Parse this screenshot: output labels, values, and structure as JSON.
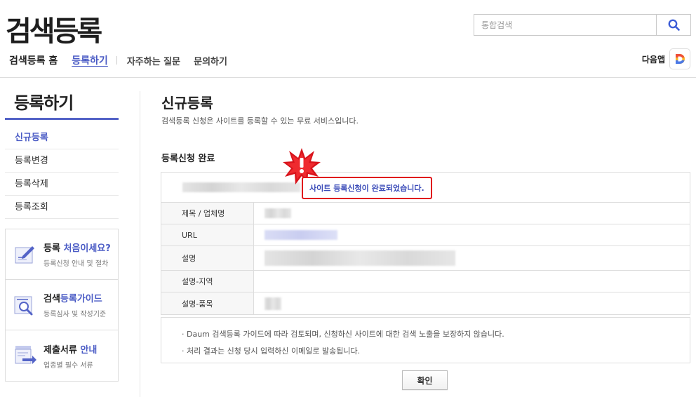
{
  "header": {
    "logo": "검색등록",
    "search_placeholder": "통합검색"
  },
  "gnb": {
    "home": "검색등록 홈",
    "register": "등록하기",
    "faq": "자주하는 질문",
    "contact": "문의하기"
  },
  "daum_app": {
    "label": "다음앱"
  },
  "sidebar": {
    "title": "등록하기",
    "items": [
      {
        "label": "신규등록"
      },
      {
        "label": "등록변경"
      },
      {
        "label": "등록삭제"
      },
      {
        "label": "등록조회"
      }
    ],
    "banners": [
      {
        "title_a": "등록 ",
        "title_b": "처음이세요?",
        "desc": "등록신청 안내 및 절차"
      },
      {
        "title_a": "검색",
        "title_b": "등록가이드",
        "desc": "등록심사 및 작성기준"
      },
      {
        "title_a": "제출서류 ",
        "title_b": "안내",
        "desc": "업종별 필수 서류"
      }
    ]
  },
  "content": {
    "title": "신규등록",
    "desc": "검색등록 신청은 사이트를 등록할 수 있는 무료 서비스입니다.",
    "section_title": "등록신청 완료",
    "result_message": "사이트 등록신청이 완료되었습니다.",
    "rows": [
      {
        "label": "제목 / 업체명"
      },
      {
        "label": "URL"
      },
      {
        "label": "설명"
      },
      {
        "label": "설명-지역"
      },
      {
        "label": "설명-품목"
      }
    ],
    "notices": [
      "· Daum 검색등록 가이드에 따라 검토되며, 신청하신 사이트에 대한 검색 노출을 보장하지 않습니다.",
      "· 처리 결과는 신청 당시 입력하신 이메일로 발송됩니다."
    ],
    "confirm_label": "확인"
  },
  "colors": {
    "accent": "#4a5bc5",
    "alert_red": "#e0141b"
  }
}
